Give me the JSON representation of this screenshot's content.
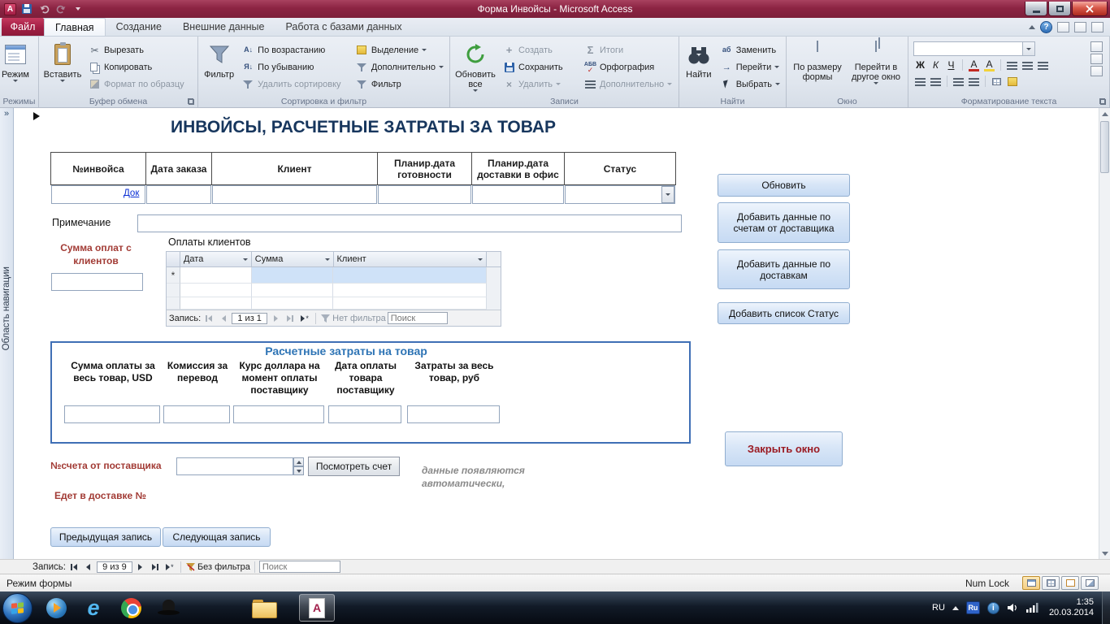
{
  "icons": {
    "app_a": "A",
    "help": "?",
    "chevrons": "»",
    "scissors": "✂",
    "sort_asc": "А↓",
    "sort_desc": "Я↓",
    "plus": "+",
    "x": "×",
    "sigma": "Σ",
    "spell_abc": "АБВ",
    "check": "✓",
    "arrow_right": "→",
    "ab": "аб",
    "bold": "Ж",
    "italic": "К",
    "underline": "Ч",
    "font_a": "А",
    "asterisk": "*",
    "ie_e": "e",
    "info_i": "i",
    "access_a": "A"
  },
  "titlebar": {
    "title": "Форма Инвойсы  -  Microsoft Access"
  },
  "ribbon": {
    "file_tab": "Файл",
    "tabs": [
      "Главная",
      "Создание",
      "Внешние данные",
      "Работа с базами данных"
    ],
    "groups": {
      "views": {
        "label": "Режимы",
        "big": "Режим"
      },
      "clipboard": {
        "label": "Буфер обмена",
        "big": "Вставить",
        "items": [
          "Вырезать",
          "Копировать",
          "Формат по образцу"
        ]
      },
      "sort": {
        "label": "Сортировка и фильтр",
        "big": "Фильтр",
        "col1": [
          "По возрастанию",
          "По убыванию",
          "Удалить сортировку"
        ],
        "col2": [
          "Выделение",
          "Дополнительно",
          "Фильтр"
        ]
      },
      "records": {
        "label": "Записи",
        "big": "Обновить все",
        "col1": [
          "Создать",
          "Сохранить",
          "Удалить"
        ],
        "col2": [
          "Итоги",
          "Орфография",
          "Дополнительно"
        ]
      },
      "find": {
        "label": "Найти",
        "big": "Найти",
        "col1": [
          "Заменить",
          "Перейти",
          "Выбрать"
        ]
      },
      "window": {
        "label": "Окно",
        "items": [
          "По размеру формы",
          "Перейти в другое окно"
        ]
      },
      "formatting": {
        "label": "Форматирование текста"
      }
    }
  },
  "nav_pane": {
    "label": "Область навигации"
  },
  "form": {
    "title": "ИНВОЙСЫ, РАСЧЕТНЫЕ ЗАТРАТЫ ЗА ТОВАР",
    "columns": [
      "№инвойса",
      "Дата заказа",
      "Клиент",
      "Планир.дата готовности",
      "Планир.дата доставки в офис",
      "Статус"
    ],
    "doc_link": "Док",
    "note_label": "Примечание",
    "payments_sum_label": "Сумма оплат с клиентов",
    "payments_title": "Оплаты клиентов",
    "subform": {
      "columns": [
        "Дата",
        "Сумма",
        "Клиент"
      ],
      "nav_label": "Запись:",
      "position": "1 из 1",
      "filter": "Нет фильтра",
      "search": "Поиск"
    },
    "costs": {
      "title": "Расчетные затраты на товар",
      "labels": [
        "Сумма оплаты за весь товар, USD",
        "Комиссия за перевод",
        "Курс доллара на момент оплаты поставщику",
        "Дата оплаты товара поставщику",
        "Затраты за весь товар, руб"
      ]
    },
    "supplier_invoice_label": "№счета от поставщика",
    "view_invoice": "Посмотреть счет",
    "auto_note_1": "данные появляются",
    "auto_note_2": "автоматически,",
    "delivery_label": "Едет в доставке №",
    "prev": "Предыдущая запись",
    "next": "Следующая запись",
    "side_buttons": [
      "Обновить",
      "Добавить данные по счетам от доставщика",
      "Добавить данные по доставкам",
      "Добавить список Статус"
    ],
    "close": "Закрыть окно"
  },
  "record_nav": {
    "label": "Запись:",
    "position": "9 из 9",
    "filter": "Без фильтра",
    "search": "Поиск"
  },
  "status": {
    "left": "Режим формы",
    "numlock": "Num Lock"
  },
  "taskbar": {
    "lang": "RU",
    "lang_badge": "Ru",
    "time": "1:35",
    "date": "20.03.2014"
  }
}
